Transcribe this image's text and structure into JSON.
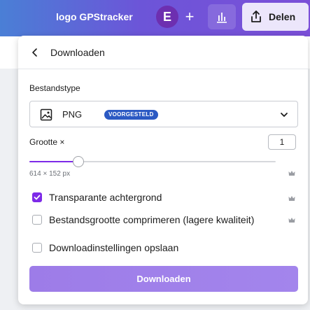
{
  "topbar": {
    "title": "logo GPStracker",
    "avatar_initial": "E",
    "add_label": "+",
    "share_label": "Delen"
  },
  "panel": {
    "title": "Downloaden",
    "filetype": {
      "label": "Bestandstype",
      "value": "PNG",
      "badge": "VOORGESTELD"
    },
    "size": {
      "label": "Grootte ×",
      "value": "1",
      "dimensions": "614 × 152 px",
      "slider_fraction": 0.2
    },
    "options": [
      {
        "label": "Transparante achtergrond",
        "checked": true
      },
      {
        "label": "Bestandsgrootte comprimeren (lagere kwaliteit)",
        "checked": false
      },
      {
        "label": "Downloadinstellingen opslaan",
        "checked": false
      }
    ],
    "download_label": "Downloaden"
  },
  "colors": {
    "accent": "#7d2ae8",
    "badge": "#2b59c3",
    "avatar": "#6d2fb0",
    "crown": "#9a9da3"
  },
  "icons": {
    "back": "chevron-left-icon",
    "filetype": "image-icon",
    "dropdown": "chevron-down-icon",
    "chart": "bar-chart-icon",
    "share": "share-upload-icon",
    "premium": "crown-icon"
  }
}
